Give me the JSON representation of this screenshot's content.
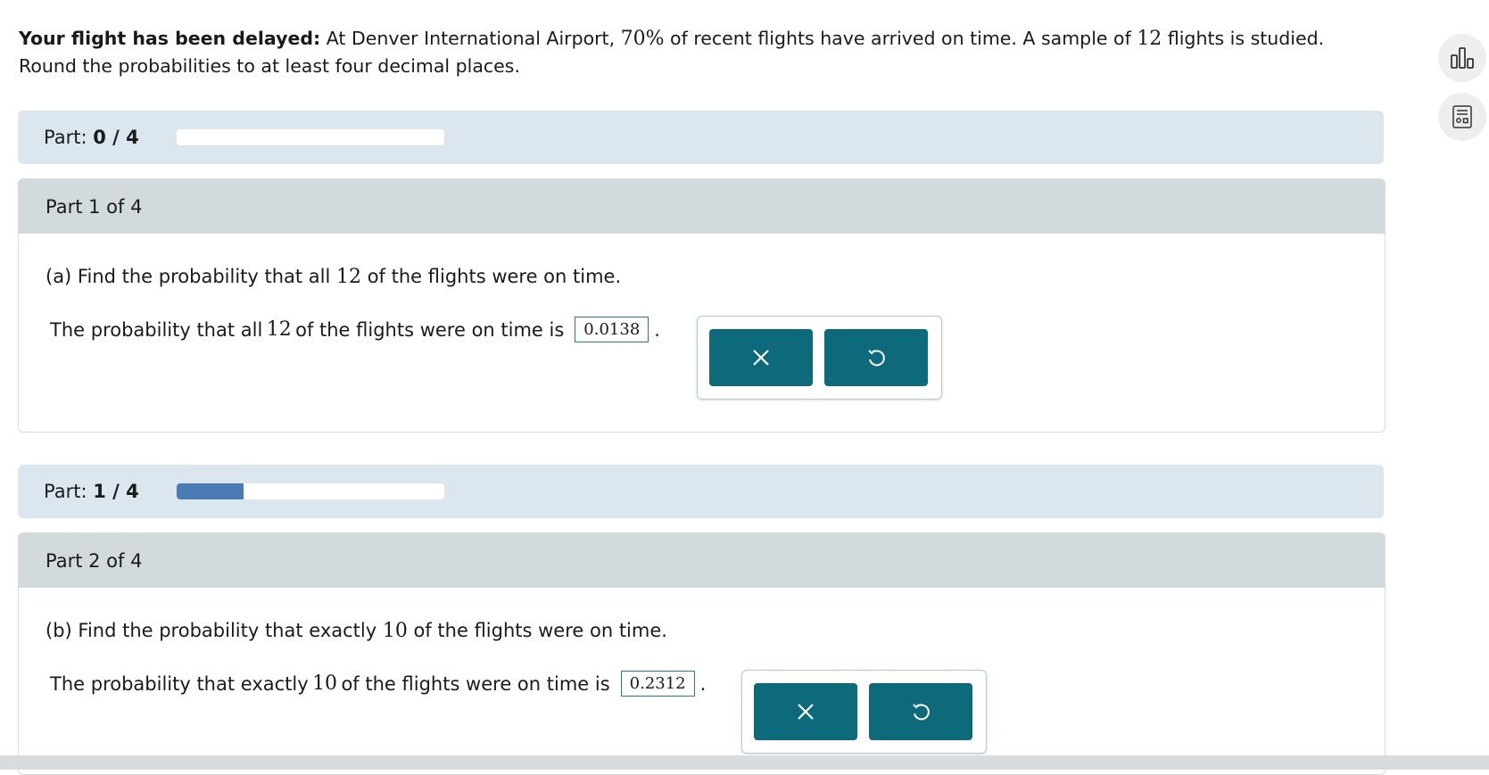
{
  "intro": {
    "bold": "Your flight has been delayed:",
    "t1": " At Denver International Airport, ",
    "m1": "70%",
    "t2": " of recent flights have arrived on time. A sample of ",
    "m2": "12",
    "t3": " flights is studied.",
    "line2": "Round the probabilities to at least four decimal places."
  },
  "sidebar": {
    "icons": [
      "bar-chart-icon",
      "calculator-icon"
    ]
  },
  "progress": [
    {
      "label": "Part:",
      "count": "0 / 4",
      "fraction": 0.0
    },
    {
      "label": "Part:",
      "count": "1 / 4",
      "fraction": 0.25
    }
  ],
  "parts": [
    {
      "header": "Part 1 of 4",
      "q_prefix": "(a) Find the probability that all ",
      "q_num": "12",
      "q_suffix": " of the flights were on time.",
      "a_prefix": "The probability that all ",
      "a_num": "12",
      "a_suffix": " of the flights were on time is",
      "answer": "0.0138",
      "period": "."
    },
    {
      "header": "Part 2 of 4",
      "q_prefix": "(b) Find the probability that exactly ",
      "q_num": "10",
      "q_suffix": " of the flights were on time.",
      "a_prefix": "The probability that exactly ",
      "a_num": "10",
      "a_suffix": " of the flights were on time is",
      "answer": "0.2312",
      "period": "."
    }
  ],
  "colors": {
    "accent": "#0d6a7a",
    "progress_fill": "#4a7bb7",
    "part_bar": "#dce6ef",
    "part_head": "#d3dadd"
  }
}
